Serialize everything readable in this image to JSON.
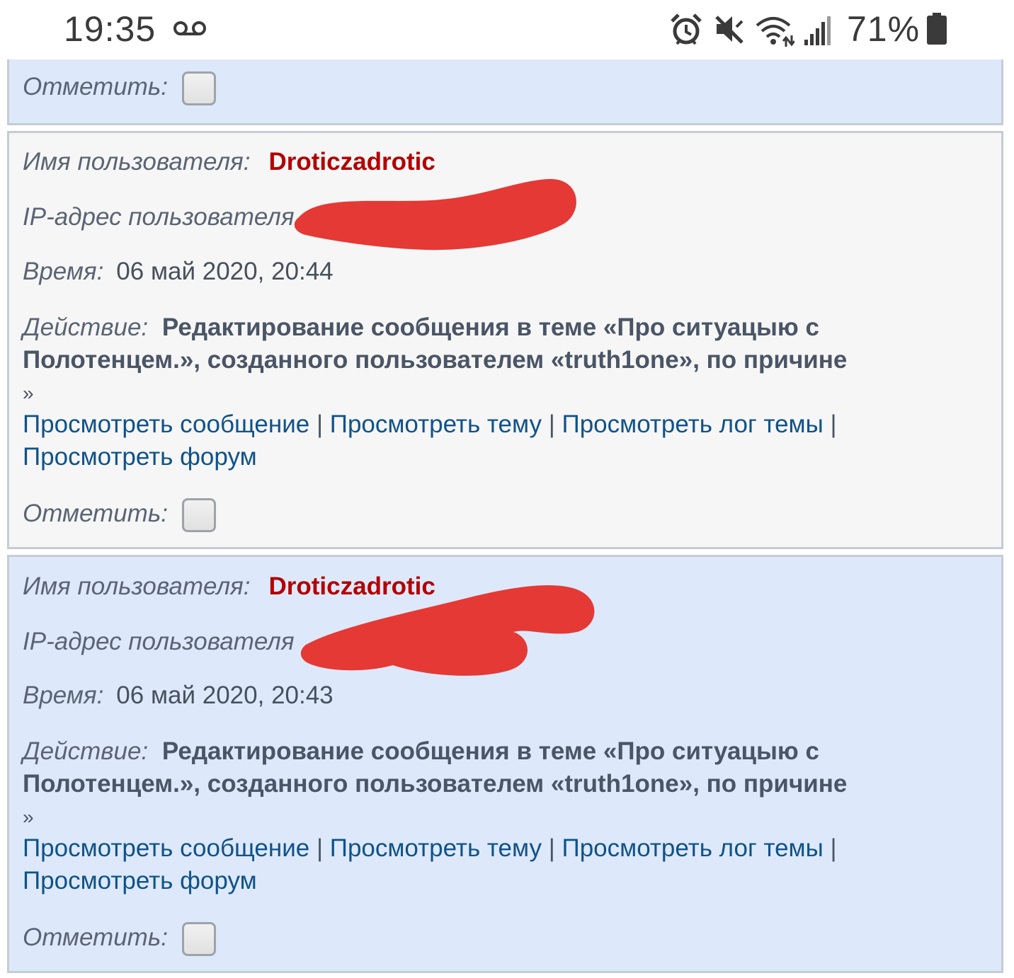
{
  "status_bar": {
    "time": "19:35",
    "battery_percent": "71%",
    "icons": [
      "voicemail-icon",
      "alarm-icon",
      "mute-icon",
      "wifi-icon",
      "signal-icon",
      "battery-icon"
    ]
  },
  "colors": {
    "panel_blue": "#dde9fb",
    "panel_grey": "#f6f6f6",
    "username": "#b30000",
    "link": "#105289",
    "redaction": "#e53935"
  },
  "top_partial_entry": {
    "mark_label": "Отметить:"
  },
  "entries": [
    {
      "username_label": "Имя пользователя:",
      "username": "Droticzadrotic",
      "ip_label": "IP-адрес пользователя",
      "time_label": "Время:",
      "time": "06 май 2020, 20:44",
      "action_label": "Действие:",
      "action_line1": "Редактирование сообщения в теме «Про ситуацыю с",
      "action_line2": "Полотенцем.», созданного пользователем «truth1one», по причине",
      "action_suffix": "»",
      "link_view_post": "Просмотреть сообщение",
      "link_view_topic": "Просмотреть тему",
      "link_view_topic_log": "Просмотреть лог темы",
      "link_view_forum": "Просмотреть форум",
      "separator": "|",
      "mark_label": "Отметить:"
    },
    {
      "username_label": "Имя пользователя:",
      "username": "Droticzadrotic",
      "ip_label": "IP-адрес пользователя",
      "time_label": "Время:",
      "time": "06 май 2020, 20:43",
      "action_label": "Действие:",
      "action_line1": "Редактирование сообщения в теме «Про ситуацыю с",
      "action_line2": "Полотенцем.», созданного пользователем «truth1one», по причине",
      "action_suffix": "»",
      "link_view_post": "Просмотреть сообщение",
      "link_view_topic": "Просмотреть тему",
      "link_view_topic_log": "Просмотреть лог темы",
      "link_view_forum": "Просмотреть форум",
      "separator": "|",
      "mark_label": "Отметить:"
    }
  ]
}
